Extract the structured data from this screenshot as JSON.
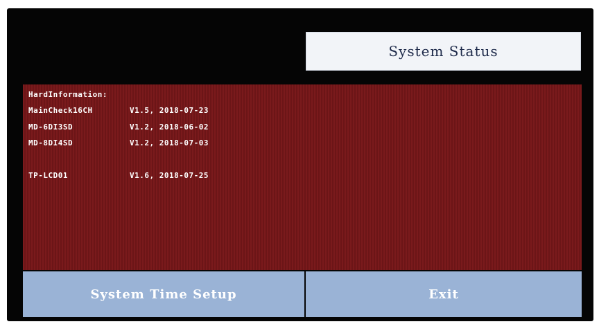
{
  "header": {
    "title": "System Status"
  },
  "hardware": {
    "heading": "HardInformation:",
    "items": [
      {
        "device": "MainCheck16CH",
        "version": "V1.5, 2018-07-23"
      },
      {
        "device": "MD-6DI3SD",
        "version": "V1.2, 2018-06-02"
      },
      {
        "device": "MD-8DI4SD",
        "version": "V1.2, 2018-07-03"
      },
      {
        "device": "TP-LCD01",
        "version": "V1.6, 2018-07-25"
      }
    ]
  },
  "buttons": {
    "time_setup": "System Time Setup",
    "exit": "Exit"
  },
  "colors": {
    "panel": "#7a1a1c",
    "button": "#9ab3d6",
    "title_box": "#f2f4f8",
    "screen": "#050505"
  }
}
